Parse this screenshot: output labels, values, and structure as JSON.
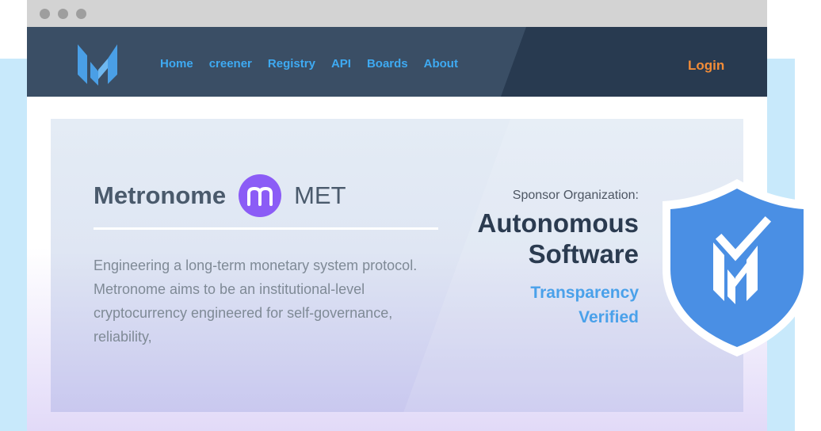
{
  "nav": {
    "links": [
      "Home",
      "creener",
      "Registry",
      "API",
      "Boards",
      "About"
    ],
    "login": "Login"
  },
  "hero": {
    "coin_name": "Metronome",
    "ticker": "MET",
    "description": "Engineering a long-term monetary system protocol. Metronome aims to be an institutional-level cryptocurrency engineered for self-governance, reliability,",
    "sponsor_label": "Sponsor Organization:",
    "sponsor_name": "Autonomous Software",
    "verified_label": "Transparency Verified"
  },
  "colors": {
    "navbar": "#3a4e65",
    "nav_link": "#3eaaf2",
    "login": "#f28c38",
    "coin_badge": "#8b5cf6",
    "shield": "#4a8fe4"
  },
  "icons": [
    "metronome-logo-icon",
    "coin-m-icon",
    "shield-check-icon"
  ]
}
